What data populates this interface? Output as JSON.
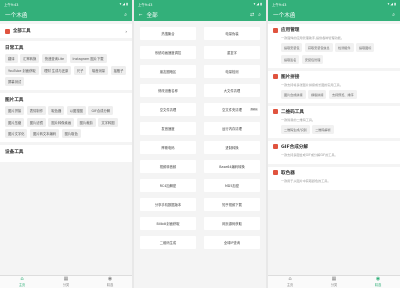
{
  "status_time": "上午9:43",
  "status_right": "▾ ◢ ▮",
  "colors": {
    "accent": "#33b07a",
    "icon_red": "#e0533e"
  },
  "panel1": {
    "title": "一个木函",
    "featured": "全部工具",
    "sections": [
      {
        "title": "日常工具",
        "chips": [
          "翻译",
          "汇率转换",
          "快递查询Lite",
          "Instagram 图片下载",
          "YouTube 封面获取",
          "理财 生成与还原",
          "尺子",
          "噪音测量",
          "摇骰子",
          "屏幕测试"
        ]
      },
      {
        "title": "图片工具",
        "chips": [
          "图片拼接",
          "表情制作",
          "取色器",
          "以图搜图",
          "GIF合成分解",
          "图片压缩",
          "图片滤镜",
          "图片转像素画",
          "图片裁剪",
          "文字转图",
          "图片文字化",
          "图片转文本编码",
          "图片取色"
        ]
      },
      {
        "title": "设备工具",
        "chips": []
      }
    ]
  },
  "panel2": {
    "title": "全部",
    "buttons": [
      "热搜聚合",
      "电量伪装",
      "系统动画速度调控",
      "重复字",
      "朋友圈暗区",
      "电量检测",
      "修改设备名称",
      "大文件清理",
      "空文件清理",
      "空文件夹清理",
      "发音速度",
      "运行内存清理",
      "摩斯电码",
      "进制转换",
      "视频转音频",
      "Base64编码转换",
      "RC4加解密",
      "MD5加密",
      "分享手机数据版本",
      "知乎视频下载",
      "Bilibili封面获取",
      "网页源码获取",
      "二维码生成",
      "全球IP查询"
    ],
    "badge": "Beta"
  },
  "panel3": {
    "title": "一个木函",
    "cards": [
      {
        "title": "应用管理",
        "desc": "一款强悍的应用管理助手,提供各种管理功能。",
        "chips": [
          "提取安装包",
          "获取安装包信息",
          "检测组件",
          "提取图标",
          "提取签名",
          "安装包管理"
        ]
      },
      {
        "title": "图片拼接",
        "desc": "一款支持将多张图片拼接成长图的实用工具。",
        "chips": [
          "图片合成拼接",
          "横版拼接",
          "支持预览、排序"
        ]
      },
      {
        "title": "二维码工具",
        "desc": "一款简易的二维码工具。",
        "chips": [
          "二维码生成/识别",
          "二维码解析"
        ]
      },
      {
        "title": "GIF合成分解",
        "desc": "一款支持多图合成GIF或分解GIF的工具。",
        "chips": []
      },
      {
        "title": "取色器",
        "desc": "一款用于从图片中获取颜色的工具。",
        "chips": []
      }
    ]
  },
  "nav": [
    {
      "icon": "⌂",
      "label": "主页"
    },
    {
      "icon": "▦",
      "label": "分类"
    },
    {
      "icon": "◉",
      "label": "精选"
    }
  ]
}
